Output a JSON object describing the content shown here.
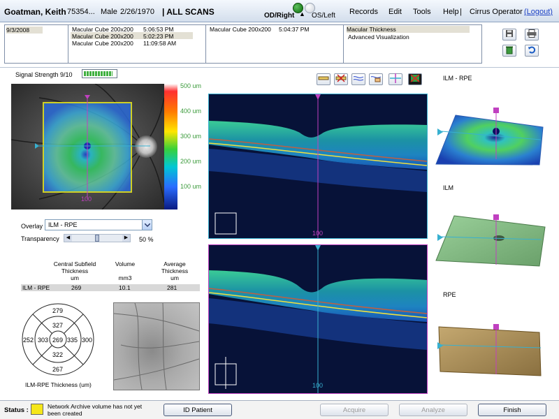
{
  "header": {
    "patient_name": "Goatman, Keith",
    "patient_id": "75354...",
    "gender": "Male",
    "dob": "2/26/1970",
    "scan_filter": "| ALL SCANS",
    "eye_right": "OD/Right",
    "eye_left": "OS/Left",
    "menu": {
      "records": "Records",
      "edit": "Edit",
      "tools": "Tools",
      "help": "Help",
      "separator": "|",
      "operator": "Cirrus Operator",
      "logout": "(Logout)"
    }
  },
  "info": {
    "date": "9/3/2008",
    "scans_col1": [
      {
        "name": "Macular Cube 200x200",
        "time": "5:06:53 PM"
      },
      {
        "name": "Macular Cube 200x200",
        "time": "5:02:23 PM"
      },
      {
        "name": "Macular Cube 200x200",
        "time": "11:09:58 AM"
      }
    ],
    "scans_col2": [
      {
        "name": "Macular Cube 200x200",
        "time": "5:04:37 PM"
      }
    ],
    "analyses": [
      "Macular Thickness",
      "Advanced Visualization"
    ]
  },
  "left_panel": {
    "signal_strength": "Signal Strength 9/10",
    "signal_value": 9,
    "signal_max": 10,
    "scale_labels": [
      "500 um",
      "400 um",
      "300 um",
      "200 um",
      "100 um"
    ],
    "fundus_slice_label": "100",
    "overlay_label": "Overlay",
    "overlay_value": "ILM - RPE",
    "transparency_label": "Transparency",
    "transparency_value": "50",
    "transparency_unit": "%"
  },
  "thickness_table": {
    "headers": [
      {
        "line1": "Central Subfield",
        "line2": "Thickness",
        "unit": "um"
      },
      {
        "line1": "Volume",
        "line2": "",
        "unit": "mm3"
      },
      {
        "line1": "Average",
        "line2": "Thickness",
        "unit": "um"
      }
    ],
    "row": {
      "label": "ILM - RPE",
      "central": "269",
      "volume": "10.1",
      "average": "281"
    }
  },
  "etdrs": {
    "center": "269",
    "inner": {
      "top": "327",
      "left": "303",
      "right": "335",
      "bottom": "322"
    },
    "outer": {
      "top": "279",
      "left": "252",
      "right": "300",
      "bottom": "267"
    },
    "caption": "ILM-RPE Thickness (um)"
  },
  "bscans": {
    "top_slice": "100",
    "bottom_slice": "100"
  },
  "right_panel": {
    "labels": [
      "ILM - RPE",
      "ILM",
      "RPE"
    ]
  },
  "status": {
    "label": "Status :",
    "message": "Network Archive volume has not yet been created",
    "color": "#f5e61a"
  },
  "buttons": {
    "id_patient": "ID Patient",
    "acquire": "Acquire",
    "analyze": "Analyze",
    "finish": "Finish"
  }
}
